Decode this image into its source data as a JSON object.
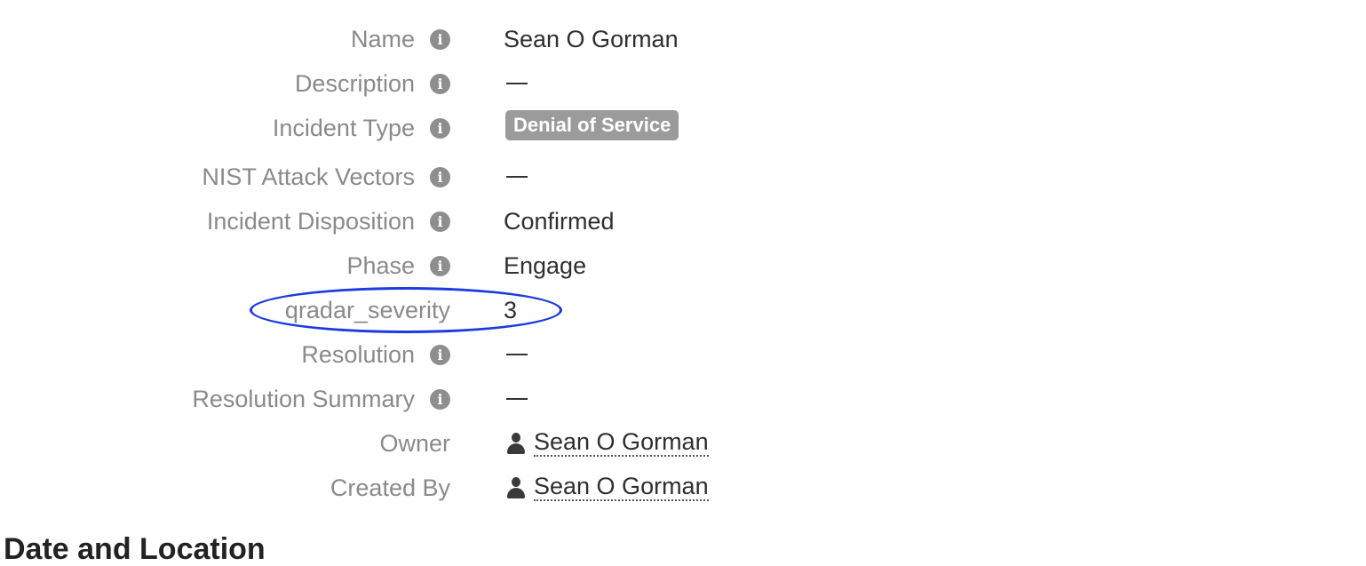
{
  "fields": [
    {
      "key": "name",
      "label": "Name",
      "value": "Sean O Gorman"
    },
    {
      "key": "description",
      "label": "Description",
      "value": "—"
    },
    {
      "key": "incident_type",
      "label": "Incident Type",
      "value": "Denial of Service"
    },
    {
      "key": "nist_attack_vectors",
      "label": "NIST Attack Vectors",
      "value": "—"
    },
    {
      "key": "incident_disposition",
      "label": "Incident Disposition",
      "value": "Confirmed"
    },
    {
      "key": "phase",
      "label": "Phase",
      "value": "Engage"
    },
    {
      "key": "qradar_severity",
      "label": "qradar_severity",
      "value": "3"
    },
    {
      "key": "resolution",
      "label": "Resolution",
      "value": "—"
    },
    {
      "key": "resolution_summary",
      "label": "Resolution Summary",
      "value": "—"
    },
    {
      "key": "owner",
      "label": "Owner",
      "value": "Sean O Gorman"
    },
    {
      "key": "created_by",
      "label": "Created By",
      "value": "Sean O Gorman"
    }
  ],
  "section": {
    "title": "Date and Location"
  },
  "colors": {
    "label": "#8a8a8a",
    "value": "#2f2f2f",
    "badge_bg": "#9b9b9b",
    "highlight": "#1b3be0"
  },
  "icons": {
    "info": "info-circle-icon",
    "user": "user-icon"
  }
}
